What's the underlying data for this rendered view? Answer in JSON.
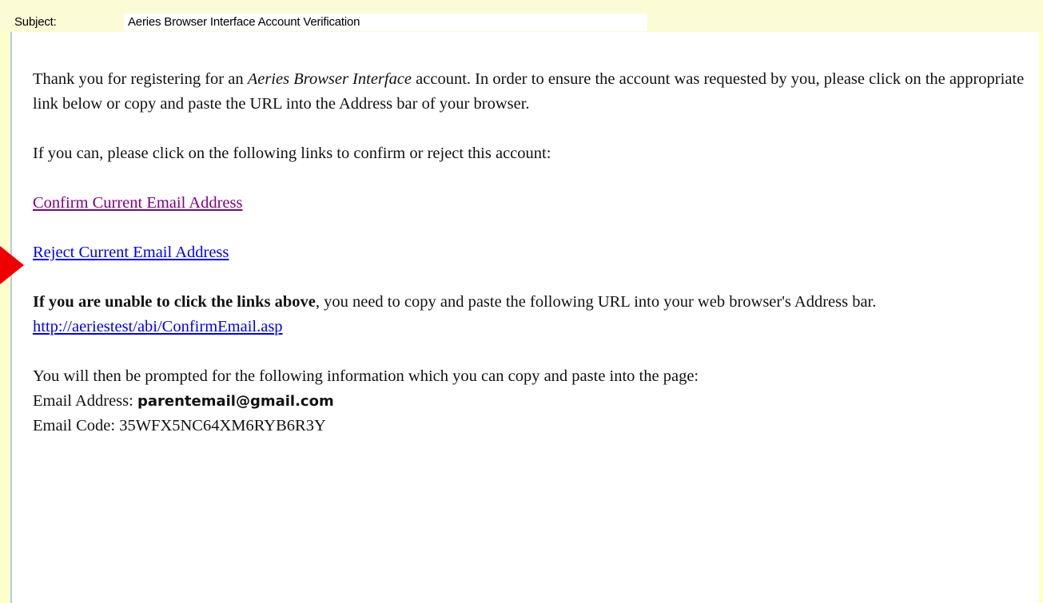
{
  "header": {
    "subject_label": "Subject:",
    "subject_value": "Aeries Browser Interface Account Verification"
  },
  "email": {
    "para1_before": "Thank you for registering for an ",
    "para1_italic": "Aeries Browser Interface",
    "para1_after": " account. In order to ensure the account was requested by you, please click on the appropriate link below or copy and paste the URL into the Address bar of your browser.",
    "para2": "If you can, please click on the following links to confirm or reject this account:",
    "confirm_link": "Confirm Current Email Address",
    "reject_link": "Reject Current Email Address",
    "para3_bold": "If you are unable to click the links above",
    "para3_rest": ", you need to copy and paste the following URL into your web browser's Address bar.",
    "url_link": "http://aeriestest/abi/ConfirmEmail.asp",
    "para4": "You will then be prompted for the following information which you can copy and paste into the page:",
    "email_address_label": "Email Address: ",
    "email_address_value": "parentemail@gmail.com",
    "email_code_label": "Email Code: ",
    "email_code_value": "35WFX5NC64XM6RYB6R3Y"
  },
  "colors": {
    "background": "#ffffcc",
    "visited_link": "#800080",
    "link": "#0000ee",
    "arrow": "#ee0000"
  },
  "icons": {
    "pointer": "red-arrow-icon"
  }
}
